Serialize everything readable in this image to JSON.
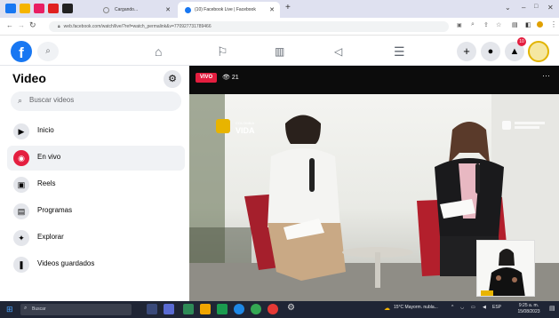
{
  "browser": {
    "tabs": [
      {
        "title": "Cargando..."
      },
      {
        "title": "(10) Facebook Live | Facebook"
      }
    ],
    "new_tab_label": "+",
    "url": "web.facebook.com/watch/live/?ref=watch_permalink&v=770927731789466"
  },
  "header": {
    "logo": "f",
    "icons": [
      "search-icon",
      "home-icon",
      "flag-icon",
      "marketplace-icon",
      "megaphone-icon",
      "menu-icon",
      "plus-icon",
      "messenger-icon",
      "notifications-icon",
      "profile-avatar"
    ],
    "notification_badge": "10"
  },
  "sidebar": {
    "title": "Video",
    "search_placeholder": "Buscar videos",
    "items": [
      {
        "label": "Inicio",
        "icon": "watch-icon",
        "selected": false
      },
      {
        "label": "En vivo",
        "icon": "live-icon",
        "selected": true
      },
      {
        "label": "Reels",
        "icon": "reels-icon",
        "selected": false
      },
      {
        "label": "Programas",
        "icon": "shows-icon",
        "selected": false
      },
      {
        "label": "Explorar",
        "icon": "explore-icon",
        "selected": false
      },
      {
        "label": "Videos guardados",
        "icon": "bookmark-icon",
        "selected": false
      }
    ]
  },
  "video": {
    "live_badge": "VIVO",
    "viewer_count": "21",
    "more_label": "···",
    "watermark_left": "COLOMBIA VIDA",
    "watermark_right": "CONSEJERÍA PRESIDENCIAL"
  },
  "taskbar": {
    "search_placeholder": "Buscar",
    "weather": "15°C  Mayorm. nubla...",
    "language": "ESP",
    "time": "9:25 a. m.",
    "date": "15/08/2023"
  },
  "colors": {
    "facebook_blue": "#1877f2",
    "live_red": "#e41e3f",
    "taskbar": "#1f2535"
  }
}
